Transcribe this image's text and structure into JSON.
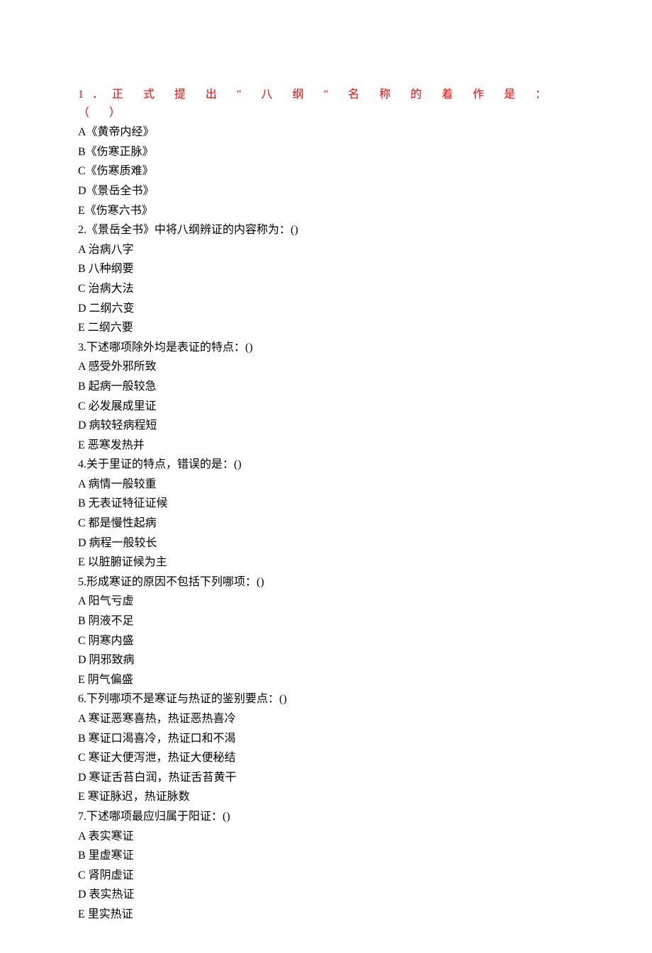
{
  "questions": [
    {
      "q": "1．正 式 提 出 \" 八 纲 \" 名 称 的 着 作 是 ： （ ）",
      "special": true,
      "options": [
        "A《黄帝内经》",
        "B《伤寒正脉》",
        "C《伤寒质难》",
        "D《景岳全书》",
        "E《伤寒六书》"
      ]
    },
    {
      "q": "2.《景岳全书》中将八纲辨证的内容称为：()",
      "options": [
        "A 治病八字",
        "B 八种纲要",
        "C 治病大法",
        "D 二纲六变",
        "E 二纲六要"
      ]
    },
    {
      "q": "3.下述哪项除外均是表证的特点：()",
      "options": [
        "A 感受外邪所致",
        "B 起病一般较急",
        "C 必发展成里证",
        "D 病较轻病程短",
        "E 恶寒发热并"
      ]
    },
    {
      "q": "4.关于里证的特点，错误的是：()",
      "options": [
        "A 病情一般较重",
        "B 无表证特征证候",
        "C 都是慢性起病",
        "D 病程一般较长",
        "E 以脏腑证候为主"
      ]
    },
    {
      "q": "5.形成寒证的原因不包括下列哪项：()",
      "options": [
        "A 阳气亏虚",
        "B 阴液不足",
        "C 阴寒内盛",
        "D 阴邪致病",
        "E 阴气偏盛"
      ]
    },
    {
      "q": "6.下列哪项不是寒证与热证的鉴别要点：()",
      "options": [
        "A 寒证恶寒喜热，热证恶热喜冷",
        "B 寒证口渴喜冷，热证口和不渴",
        "C 寒证大便泻泄，热证大便秘结",
        "D 寒证舌苔白润，热证舌苔黄干",
        "E 寒证脉迟，热证脉数"
      ]
    },
    {
      "q": "7.下述哪项最应归属于阳证：()",
      "options": [
        "A 表实寒证",
        "B 里虚寒证",
        "C 肾阴虚证",
        "D 表实热证",
        "E 里实热证"
      ]
    }
  ]
}
